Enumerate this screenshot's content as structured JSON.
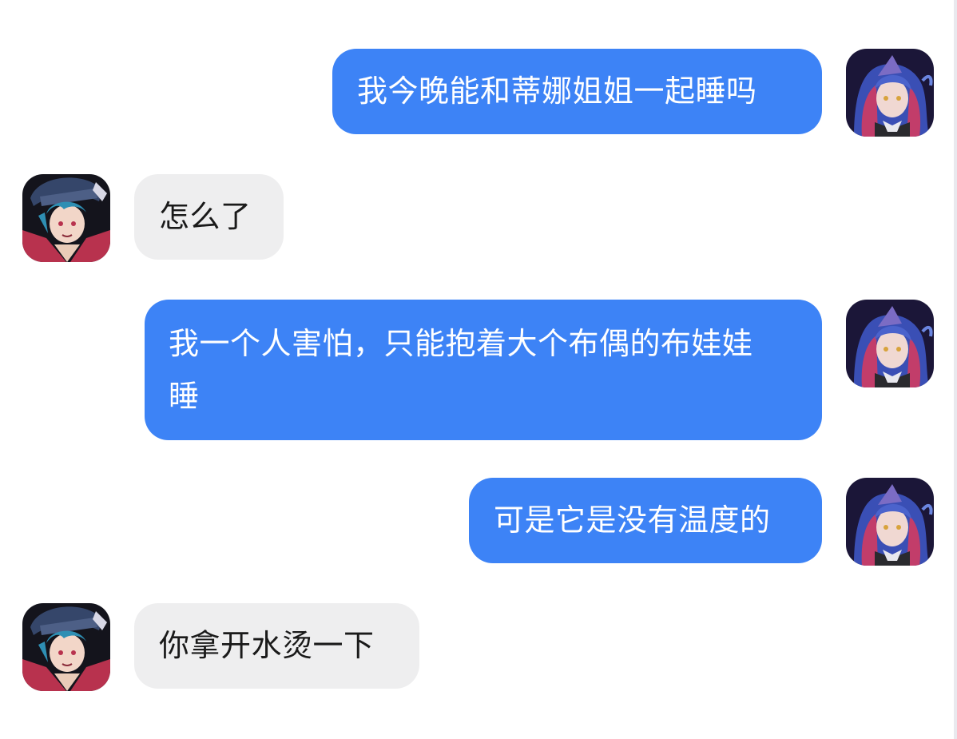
{
  "conversation": {
    "messages": [
      {
        "sender": "self",
        "text": "我今晚能和蒂娜姐姐一起睡吗",
        "avatar_icon": "girl-avatar-icon"
      },
      {
        "sender": "other",
        "text": "怎么了",
        "avatar_icon": "boy-avatar-icon"
      },
      {
        "sender": "self",
        "text": "我一个人害怕，只能抱着大个布偶的布娃娃睡",
        "avatar_icon": "girl-avatar-icon"
      },
      {
        "sender": "self",
        "text": "可是它是没有温度的",
        "avatar_icon": "girl-avatar-icon"
      },
      {
        "sender": "other",
        "text": "你拿开水烫一下",
        "avatar_icon": "boy-avatar-icon"
      }
    ]
  },
  "colors": {
    "sent_bubble": "#3d83f6",
    "received_bubble": "#eeeeef",
    "sent_text": "#ffffff",
    "received_text": "#1a1a1a",
    "background": "#ffffff"
  }
}
